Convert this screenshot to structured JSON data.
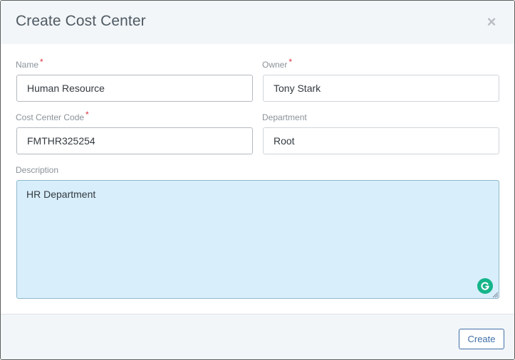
{
  "dialog": {
    "title": "Create Cost Center",
    "close_icon": "close-icon",
    "close_glyph": "×"
  },
  "form": {
    "name": {
      "label": "Name",
      "required_marker": "*",
      "value": "Human Resource"
    },
    "owner": {
      "label": "Owner",
      "required_marker": "*",
      "value": "Tony Stark"
    },
    "cost_center_code": {
      "label": "Cost Center Code",
      "required_marker": "*",
      "value": "FMTHR325254"
    },
    "department": {
      "label": "Department",
      "value": "Root"
    },
    "description": {
      "label": "Description",
      "value": "HR Department"
    }
  },
  "footer": {
    "create_label": "Create"
  },
  "colors": {
    "header_bg": "#f2f6f8",
    "accent": "#3f6fa8",
    "required": "#e0303a",
    "textarea_bg": "#d8eefb",
    "grammarly": "#15b58a"
  }
}
